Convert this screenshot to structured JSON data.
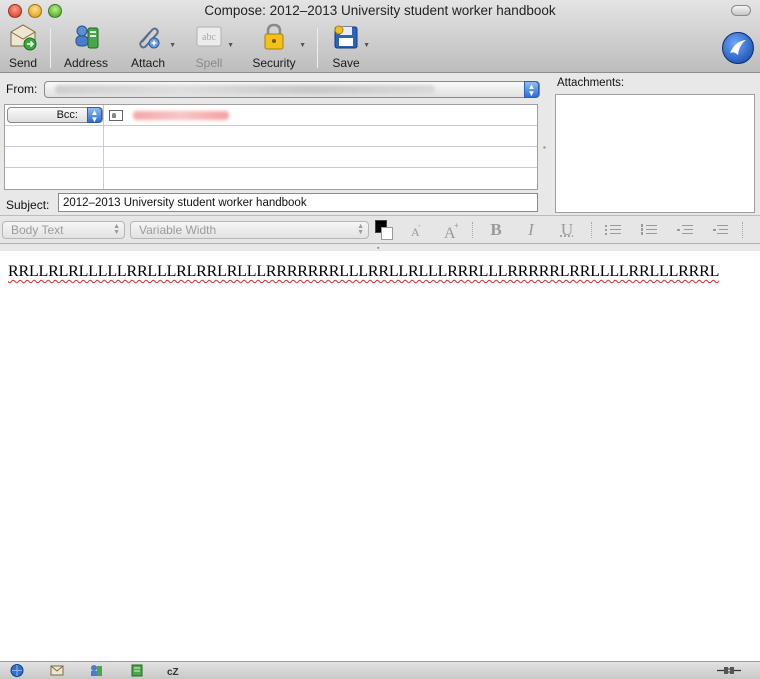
{
  "window": {
    "title": "Compose: 2012–2013 University student worker handbook"
  },
  "toolbar": {
    "send": "Send",
    "address": "Address",
    "attach": "Attach",
    "spell": "Spell",
    "security": "Security",
    "save": "Save"
  },
  "header": {
    "from_label": "From:",
    "bcc_label": "Bcc:",
    "subject_label": "Subject:",
    "subject_value": "2012–2013 University student worker handbook",
    "attachments_label": "Attachments:"
  },
  "format_bar": {
    "paragraph_style": "Body Text",
    "font": "Variable Width"
  },
  "message": {
    "body": "RRLLRLRLLLLLRRLLLRLRRLRLLLRRRRRRRLLLRRLLRLLLRRRLLLRRRRRLRRLLLLRRLLLRRRL"
  },
  "colors": {
    "accent_blue": "#2c6fd8",
    "spell_error": "#d12b2b"
  }
}
